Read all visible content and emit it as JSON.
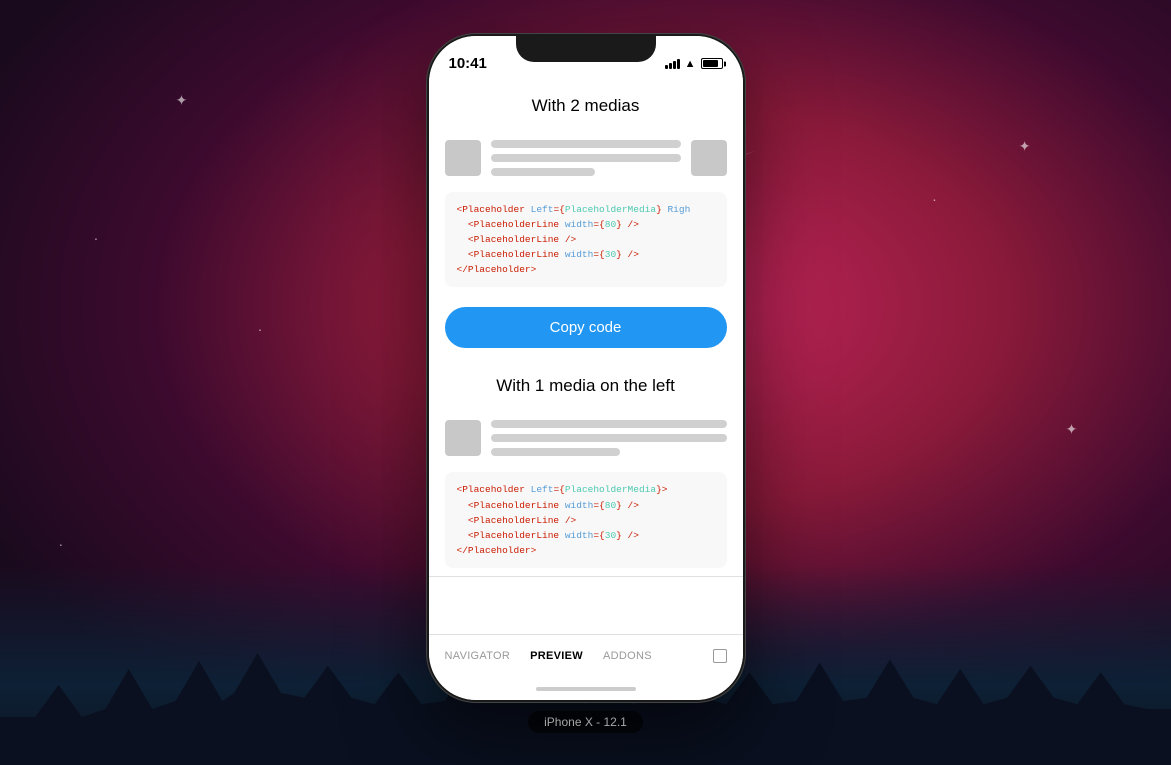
{
  "background": {
    "color1": "#c0245a",
    "color2": "#1a0a1e"
  },
  "phone": {
    "label": "iPhone X - 12.1"
  },
  "statusBar": {
    "time": "10:41"
  },
  "section1": {
    "title": "With 2 medias",
    "code": {
      "line1": "<Placeholder Left={PlaceholderMedia} Righ",
      "line2": "  <PlaceholderLine width={80} />",
      "line3": "  <PlaceholderLine />",
      "line4": "  <PlaceholderLine width={30} />",
      "line5": "</Placeholder>"
    },
    "copyButton": "Copy code"
  },
  "section2": {
    "title": "With 1 media on the left",
    "code": {
      "line1": "<Placeholder Left={PlaceholderMedia}>",
      "line2": "  <PlaceholderLine width={80} />",
      "line3": "  <PlaceholderLine />",
      "line4": "  <PlaceholderLine width={30} />",
      "line5": "</Placeholder>"
    }
  },
  "bottomTabs": {
    "items": [
      {
        "label": "NAVIGATOR",
        "active": false
      },
      {
        "label": "PREVIEW",
        "active": true
      },
      {
        "label": "ADDONS",
        "active": false
      }
    ]
  }
}
